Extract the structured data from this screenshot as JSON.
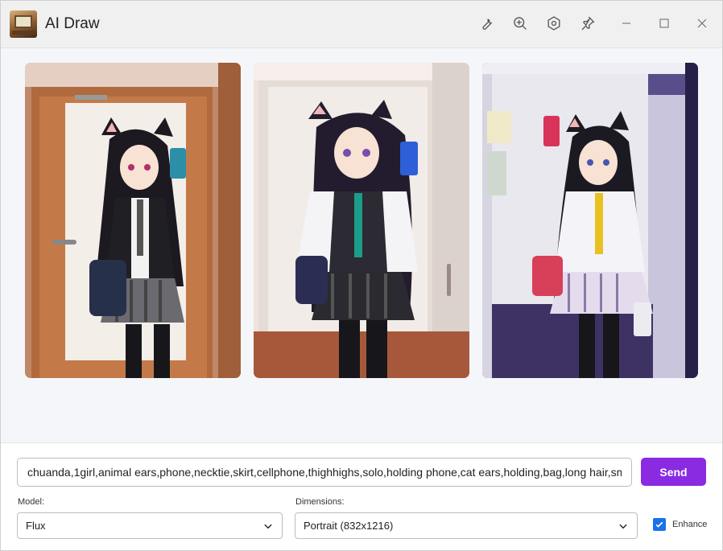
{
  "app": {
    "title": "AI Draw",
    "icon": "room-thumbnail-icon"
  },
  "titlebar": {
    "buttons": [
      {
        "name": "wrench-icon"
      },
      {
        "name": "zoom-in-icon"
      },
      {
        "name": "settings-icon"
      },
      {
        "name": "pin-icon"
      },
      {
        "name": "minimize-icon"
      },
      {
        "name": "maximize-icon"
      },
      {
        "name": "close-icon"
      }
    ]
  },
  "gallery": {
    "images": [
      {
        "description": "anime girl with cat ears taking mirror selfie, brown door"
      },
      {
        "description": "anime girl with cat ears taking selfie, white door"
      },
      {
        "description": "anime girl with cat ears taking selfie, hallway"
      }
    ]
  },
  "prompt": {
    "value": "chuanda,1girl,animal ears,phone,necktie,skirt,cellphone,thighhighs,solo,holding phone,cat ears,holding,bag,long hair,smartphone"
  },
  "send_label": "Send",
  "model": {
    "label": "Model:",
    "selected": "Flux"
  },
  "dimensions": {
    "label": "Dimensions:",
    "selected": "Portrait (832x1216)"
  },
  "enhance": {
    "label": "Enhance",
    "checked": true
  },
  "colors": {
    "accent": "#8a2be2",
    "checkbox": "#1a73e8"
  }
}
